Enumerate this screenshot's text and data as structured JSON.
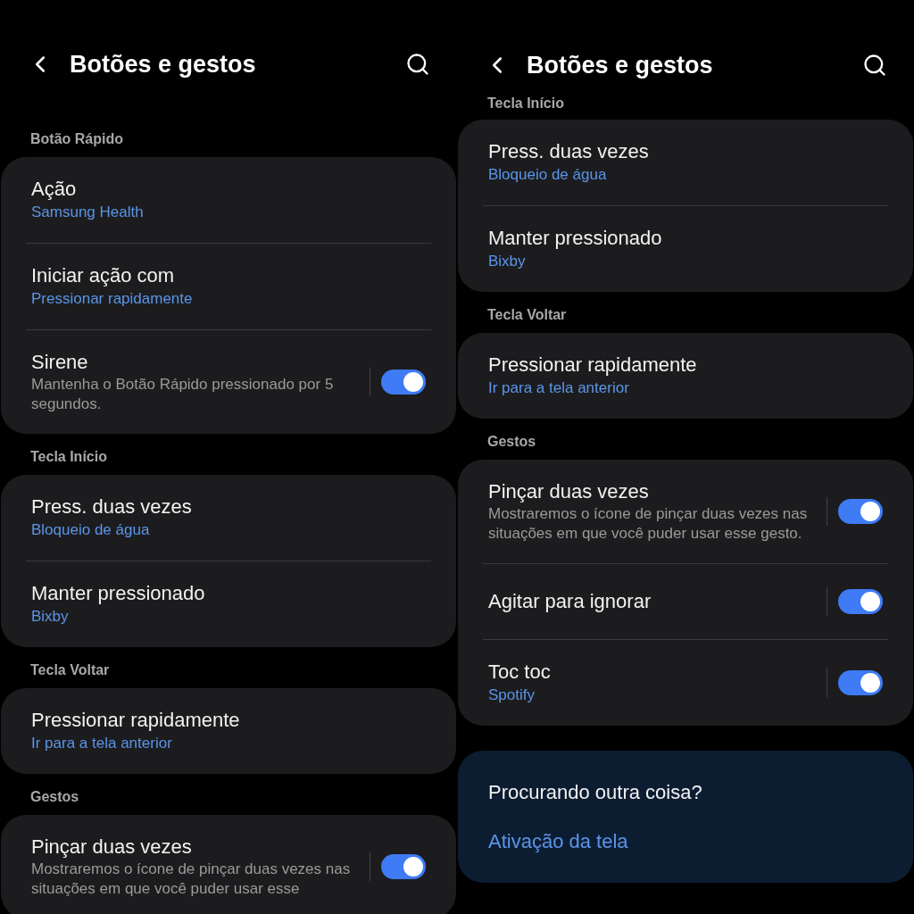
{
  "screens": [
    {
      "title": "Botões e gestos",
      "sections": [
        {
          "header": "Botão Rápido",
          "items": [
            {
              "kind": "link",
              "title": "Ação",
              "value": "Samsung Health"
            },
            {
              "kind": "link",
              "title": "Iniciar ação com",
              "value": "Pressionar rapidamente"
            },
            {
              "kind": "switch",
              "title": "Sirene",
              "description": "Mantenha o Botão Rápido pressionado por 5 segundos.",
              "on": true
            }
          ]
        },
        {
          "header": "Tecla Início",
          "items": [
            {
              "kind": "link",
              "title": "Press. duas vezes",
              "value": "Bloqueio de água"
            },
            {
              "kind": "link",
              "title": "Manter pressionado",
              "value": "Bixby"
            }
          ]
        },
        {
          "header": "Tecla Voltar",
          "items": [
            {
              "kind": "link",
              "title": "Pressionar rapidamente",
              "value": "Ir para a tela anterior"
            }
          ]
        },
        {
          "header": "Gestos",
          "items": [
            {
              "kind": "switch",
              "title": "Pinçar duas vezes",
              "description": "Mostraremos o ícone de pinçar duas vezes nas situações em que você puder usar esse",
              "on": true
            }
          ]
        }
      ]
    },
    {
      "title": "Botões e gestos",
      "sections": [
        {
          "header": "Tecla Início",
          "items": [
            {
              "kind": "link",
              "title": "Press. duas vezes",
              "value": "Bloqueio de água"
            },
            {
              "kind": "link",
              "title": "Manter pressionado",
              "value": "Bixby"
            }
          ]
        },
        {
          "header": "Tecla Voltar",
          "items": [
            {
              "kind": "link",
              "title": "Pressionar rapidamente",
              "value": "Ir para a tela anterior"
            }
          ]
        },
        {
          "header": "Gestos",
          "items": [
            {
              "kind": "switch",
              "title": "Pinçar duas vezes",
              "description": "Mostraremos o ícone de pinçar duas vezes nas situações em que você puder usar esse gesto.",
              "on": true
            },
            {
              "kind": "switch",
              "title": "Agitar para ignorar",
              "on": true
            },
            {
              "kind": "switch",
              "title": "Toc toc",
              "value": "Spotify",
              "on": true
            }
          ]
        }
      ],
      "suggestions": {
        "title": "Procurando outra coisa?",
        "links": [
          "Ativação da tela"
        ]
      }
    }
  ]
}
